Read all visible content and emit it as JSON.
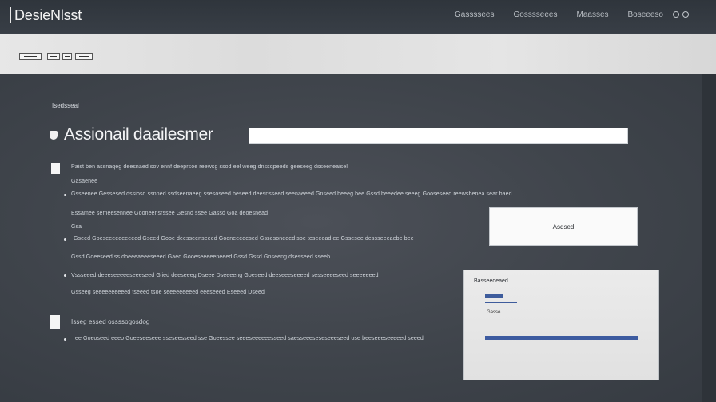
{
  "app": {
    "brand": "DesieNlsst"
  },
  "nav": {
    "items": [
      "Gassssees",
      "Gosssseees",
      "Maasses",
      "Boseeeso"
    ]
  },
  "toolbar": {
    "buttons": [
      "—",
      "1",
      "1"
    ]
  },
  "main": {
    "section_label": "Isedsseal",
    "title": "Assionail daailesmer",
    "title_input_value": "",
    "lines": {
      "l1": "Paist ben assnaqeg deesnaed sov ennf deeprsoe reewsg ssod eel weeg dnssqpeeds geeseeg dsseeneaisel",
      "l2": "Gasaenee",
      "l3": "Gsseenee Gessesed dssiosd ssnned ssdseenaeeg ssesoseed beseed deesnsseed seenaeeed Gnseed beeeg bee Gssd beeedee seeeg Gooseseed reewsbenea sear baed",
      "l4": "Essamee semeesennee Gooneensrssee Gesnd ssee Gassd Goa deoesnead",
      "l5": "Gsa",
      "l6": "Gseed Goeseeeeeeeeeed Gseed Gooe deesseenseeed Gooneeeeesed Gssesoneeed soe teseeead ee Gssesee dessseeeaebe bee",
      "l7": "Gssd Goeeseed ss doeeeaeeeseeed Gaed Gooeseeeeeneeed Gssd Gssd Goseeng dsesseed sseeb",
      "l8": "Vssseeed deeeseeeeeseeeseed Giied deeseeeg Dseee Dseeeeng Goeseed deeseeeseeeed sesseeeeseed seeeeeeed",
      "l9": "Gsseeg seeeeeeeeeed tseeed tsoe seeeeeeeeed eeeseeed Eseeed Dseed",
      "l10": "Isseg essed ossssogosdog",
      "l11": "ee Goeoseed eeeo Goeeseeseee sseseesseed sse Goeessee seeeseeeeeesseed saesseeeseseseeeseed ose beeseeeseeeeed seeed"
    },
    "action_button": "Asdsed",
    "card": {
      "title": "Basseedeaed",
      "field_label": "Gasso"
    }
  },
  "colors": {
    "accent": "#3e5c9c",
    "background": "#3b4149"
  }
}
